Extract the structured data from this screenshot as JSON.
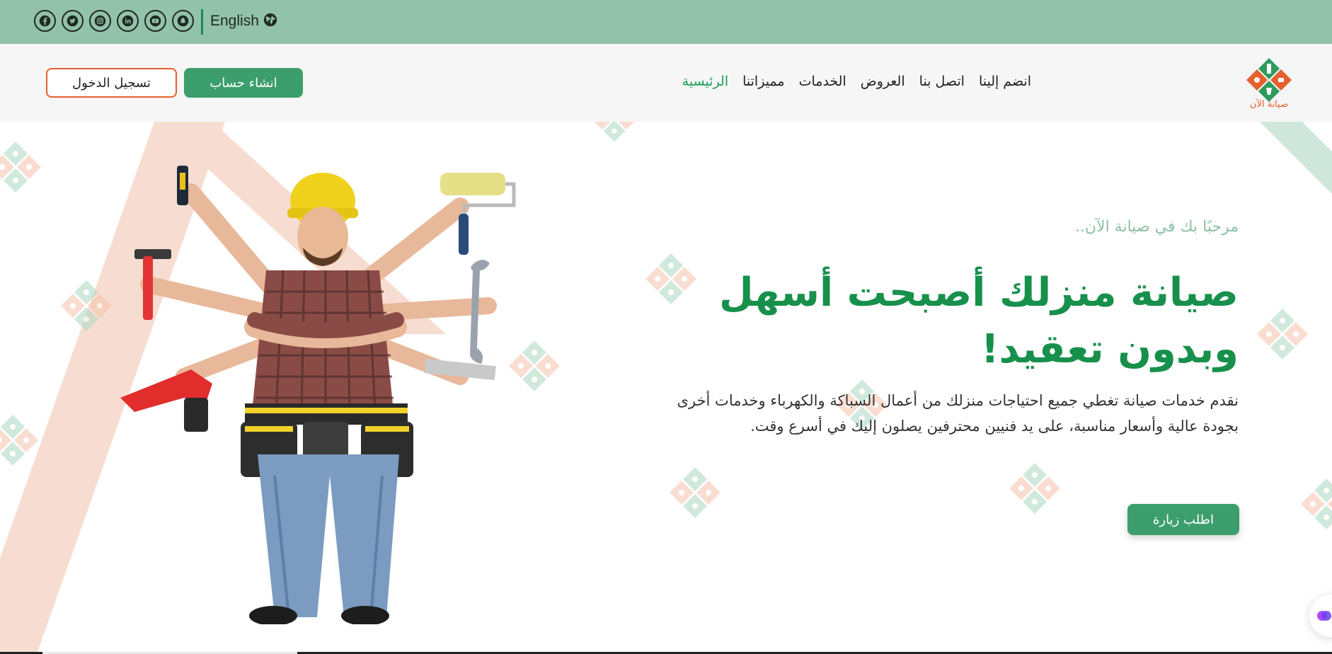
{
  "topbar": {
    "social_icons": [
      "facebook-icon",
      "twitter-icon",
      "instagram-icon",
      "linkedin-icon",
      "youtube-icon",
      "snapchat-icon"
    ],
    "language_label": "English",
    "language_icon": "globe-icon",
    "background_color": "#93c2ab"
  },
  "navbar": {
    "logo_text": "صيانة الآن",
    "links": [
      {
        "label": "الرئيسية",
        "active": true
      },
      {
        "label": "مميزاتنا",
        "active": false
      },
      {
        "label": "الخدمات",
        "active": false
      },
      {
        "label": "العروض",
        "active": false
      },
      {
        "label": "اتصل بنا",
        "active": false
      },
      {
        "label": "انضم إلينا",
        "active": false
      }
    ],
    "signup_label": "انشاء حساب",
    "login_label": "تسجيل الدخول"
  },
  "hero": {
    "welcome": "مرحبًا بك في صيانة الآن..",
    "headline": "صيانة منزلك أصبحت أسهل وبدون تعقيد!",
    "description": "نقدم خدمات صيانة تغطي جميع احتياجات منزلك من أعمال السباكة والكهرباء وخدمات أخرى بجودة عالية وأسعار مناسبة، على يد فنيين محترفين يصلون إليك في أسرع وقت.",
    "cta_label": "اطلب زيارة"
  },
  "colors": {
    "brand_green": "#17904c",
    "button_green": "#3d9e6d",
    "accent_orange": "#e4602f",
    "light_green": "#8fc0a6"
  }
}
